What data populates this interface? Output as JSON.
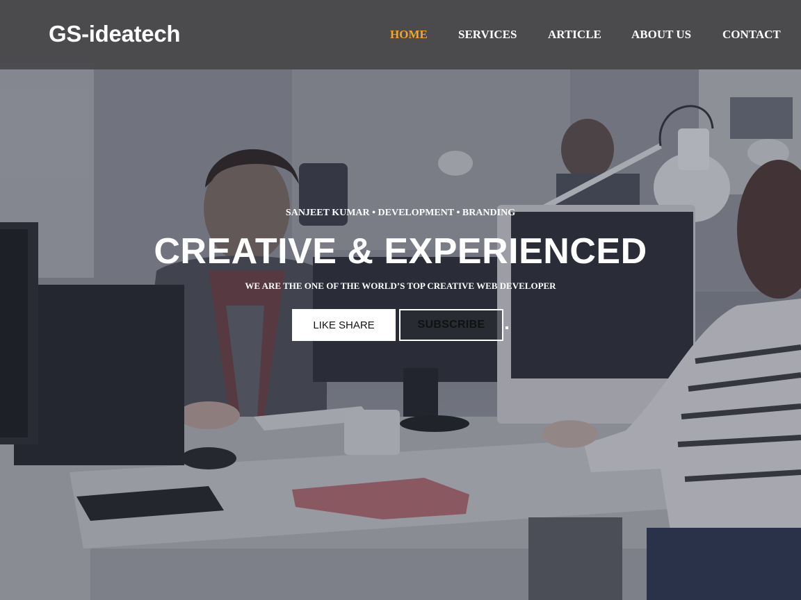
{
  "brand": {
    "name": "GS-ideatech"
  },
  "nav": {
    "items": [
      {
        "label": "HOME",
        "active": true
      },
      {
        "label": "SERVICES",
        "active": false
      },
      {
        "label": "ARTICLE",
        "active": false
      },
      {
        "label": "ABOUT US",
        "active": false
      },
      {
        "label": "CONTACT",
        "active": false
      }
    ]
  },
  "hero": {
    "kicker": "SANJEET KUMAR • DEVELOPMENT • BRANDING",
    "headline": "CREATIVE & EXPERIENCED",
    "tagline": "WE ARE THE ONE OF THE WORLD’S TOP CREATIVE WEB DEVELOPER",
    "buttons": {
      "primary": "LIKE SHARE",
      "secondary": "SUBSCRIBE"
    }
  },
  "colors": {
    "nav_background": "#464648",
    "active_link": "#f5a623",
    "text": "#ffffff",
    "overlay": "#282c3c"
  }
}
